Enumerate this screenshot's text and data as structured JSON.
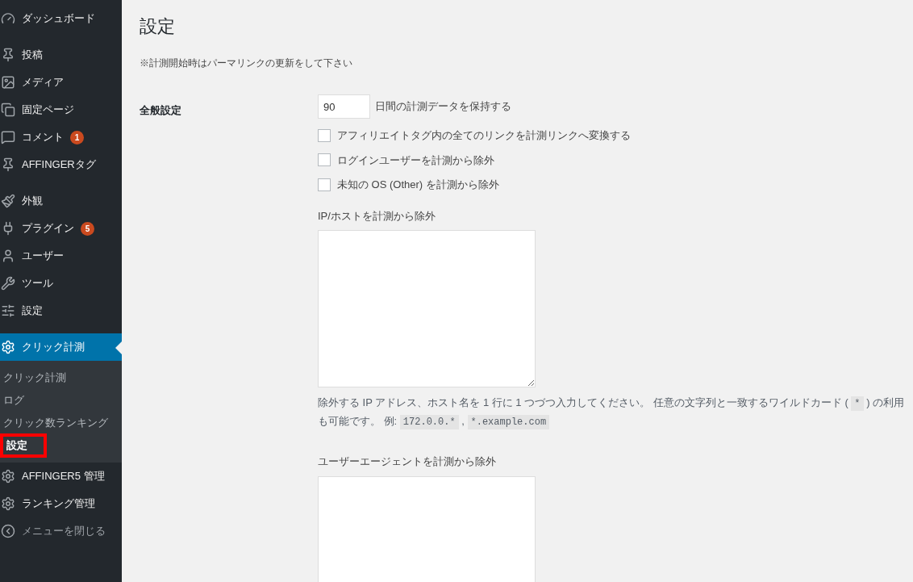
{
  "sidebar": {
    "groups": [
      [
        {
          "label": "ダッシュボード",
          "kind": "dashboard"
        }
      ],
      [
        {
          "label": "投稿",
          "kind": "pin"
        },
        {
          "label": "メディア",
          "kind": "media"
        },
        {
          "label": "固定ページ",
          "kind": "page"
        },
        {
          "label": "コメント",
          "kind": "comment",
          "badge": "1"
        },
        {
          "label": "AFFINGERタグ",
          "kind": "pin"
        }
      ],
      [
        {
          "label": "外観",
          "kind": "brush"
        },
        {
          "label": "プラグイン",
          "kind": "plug",
          "badge": "5"
        },
        {
          "label": "ユーザー",
          "kind": "user"
        },
        {
          "label": "ツール",
          "kind": "wrench"
        },
        {
          "label": "設定",
          "kind": "sliders"
        }
      ],
      [
        {
          "label": "クリック計測",
          "kind": "gear",
          "selected": true,
          "submenu": [
            {
              "label": "クリック計測",
              "selected": false,
              "highlighted": false
            },
            {
              "label": "ログ",
              "selected": false,
              "highlighted": false
            },
            {
              "label": "クリック数ランキング",
              "selected": false,
              "highlighted": false
            },
            {
              "label": "設定",
              "selected": true,
              "highlighted": true
            }
          ]
        },
        {
          "label": "AFFINGER5 管理",
          "kind": "gear",
          "selected": false
        },
        {
          "label": "ランキング管理",
          "kind": "gear",
          "selected": false
        },
        {
          "label": "メニューを閉じる",
          "kind": "collapse",
          "dim": true
        }
      ]
    ]
  },
  "page": {
    "title": "設定",
    "notice": "※計測開始時はパーマリンクの更新をして下さい"
  },
  "section": {
    "label": "全般設定",
    "retention": {
      "value": "90",
      "suffix": "日間の計測データを保持する"
    },
    "checkboxes": [
      {
        "label": "アフィリエイトタグ内の全てのリンクを計測リンクへ変換する",
        "checked": false
      },
      {
        "label": "ログインユーザーを計測から除外",
        "checked": false
      },
      {
        "label": "未知の OS (Other) を計測から除外",
        "checked": false
      }
    ],
    "ip_exclude": {
      "label": "IP/ホストを計測から除外",
      "help": [
        {
          "kind": "text",
          "text": "除外する IP アドレス、ホスト名を 1 行に 1 つづつ入力してください。 任意の文字列と一致するワイルドカード ( "
        },
        {
          "kind": "code",
          "text": "*"
        },
        {
          "kind": "text",
          "text": " ) の利用も可能です。 例: "
        },
        {
          "kind": "code",
          "text": "172.0.0.*"
        },
        {
          "kind": "text",
          "text": " , "
        },
        {
          "kind": "code",
          "text": "*.example.com"
        }
      ]
    },
    "ua_exclude": {
      "label": "ユーザーエージェントを計測から除外"
    }
  }
}
